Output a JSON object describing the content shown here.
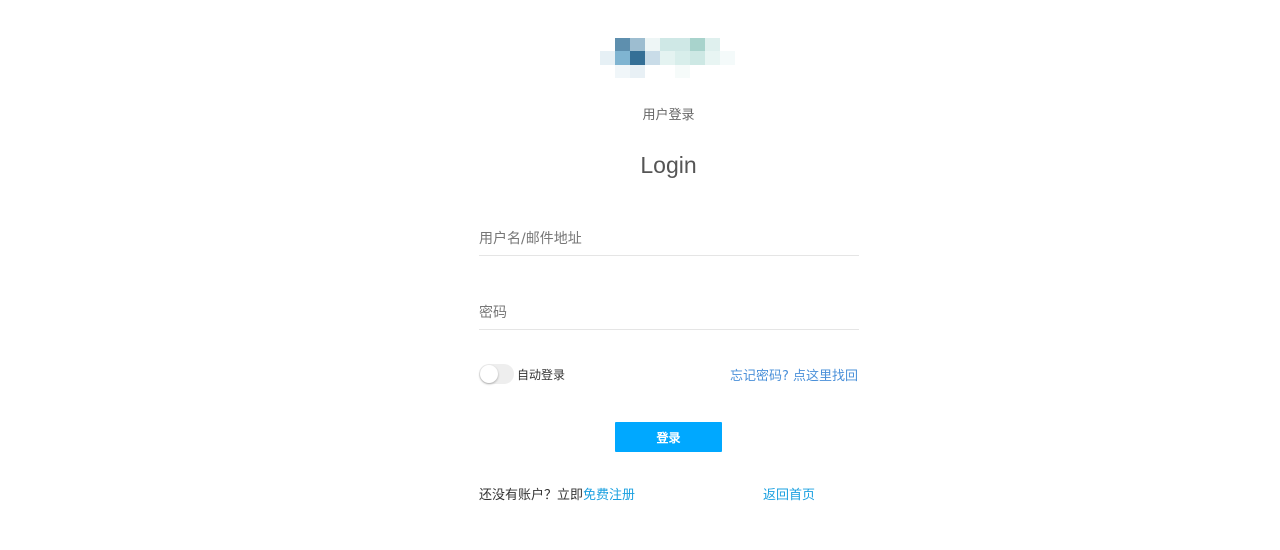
{
  "brand": {
    "logo_pixels": [
      "#ffffff",
      "#5e8fae",
      "#9dbdd0",
      "#eef6f6",
      "#cfe8e6",
      "#cfe8e6",
      "#a8d3cc",
      "#dff0ee",
      "#ffffff",
      "#e6f0f5",
      "#7fb4d1",
      "#356f96",
      "#c9dce8",
      "#e4f3f1",
      "#d8eeeb",
      "#cde8e4",
      "#e8f5f3",
      "#f4fafa",
      "#ffffff",
      "#f0f6f9",
      "#e8f0f5",
      "#ffffff",
      "#ffffff",
      "#f6fbfa",
      "#ffffff",
      "#ffffff",
      "#ffffff"
    ]
  },
  "header": {
    "subtitle": "用户登录",
    "title": "Login"
  },
  "form": {
    "username_placeholder": "用户名/邮件地址",
    "username_value": "",
    "password_placeholder": "密码",
    "password_value": "",
    "remember_label": "自动登录",
    "remember_on": false,
    "forgot_link": "忘记密码? 点这里找回",
    "submit_label": "登录"
  },
  "footer": {
    "no_account_text": "还没有账户？立即",
    "register_link": "免费注册",
    "home_link": "返回首页"
  },
  "colors": {
    "primary_button": "#00a8ff",
    "link": "#1aa0e0",
    "forgot_link": "#4a90d9"
  }
}
